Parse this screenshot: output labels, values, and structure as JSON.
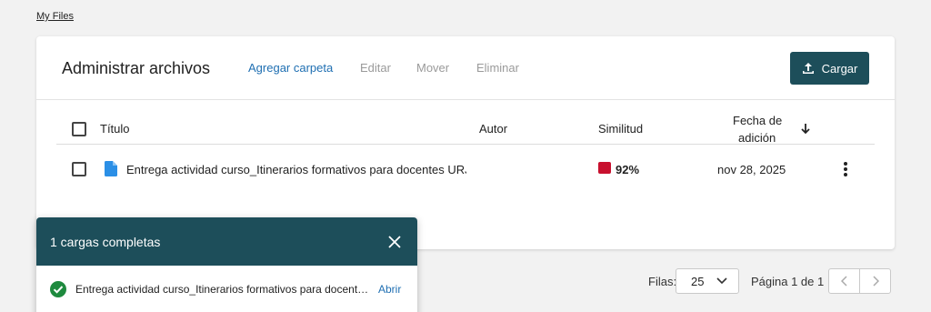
{
  "breadcrumb": "My Files",
  "header": {
    "title": "Administrar archivos",
    "actions": [
      "Agregar carpeta",
      "Editar",
      "Mover",
      "Eliminar"
    ],
    "upload_label": "Cargar"
  },
  "table": {
    "columns": [
      "Título",
      "Autor",
      "Similitud",
      "Fecha de",
      "adición"
    ],
    "rows": [
      {
        "title": "Entrega actividad curso_Itinerarios formativos para docentes URJC",
        "author": "",
        "similarity": "92%",
        "date": "nov 28, 2025"
      }
    ]
  },
  "pagination": {
    "rows_label": "Filas:",
    "rows_value": "25",
    "page_label": "Página 1 de 1"
  },
  "toast": {
    "title": "1 cargas completas",
    "file": "Entrega actividad curso_Itinerarios formativos para docentes URJC",
    "open_label": "Abrir"
  },
  "colors": {
    "brand": "#1d4e5a",
    "link": "#1f6fb2",
    "similarity_high": "#c8102e",
    "success": "#1e8a3e"
  },
  "icons": [
    "upload-icon",
    "file-icon",
    "more-vertical-icon",
    "arrow-down-icon",
    "chevron-down-icon",
    "chevron-left-icon",
    "chevron-right-icon",
    "close-icon",
    "check-circle-icon"
  ]
}
